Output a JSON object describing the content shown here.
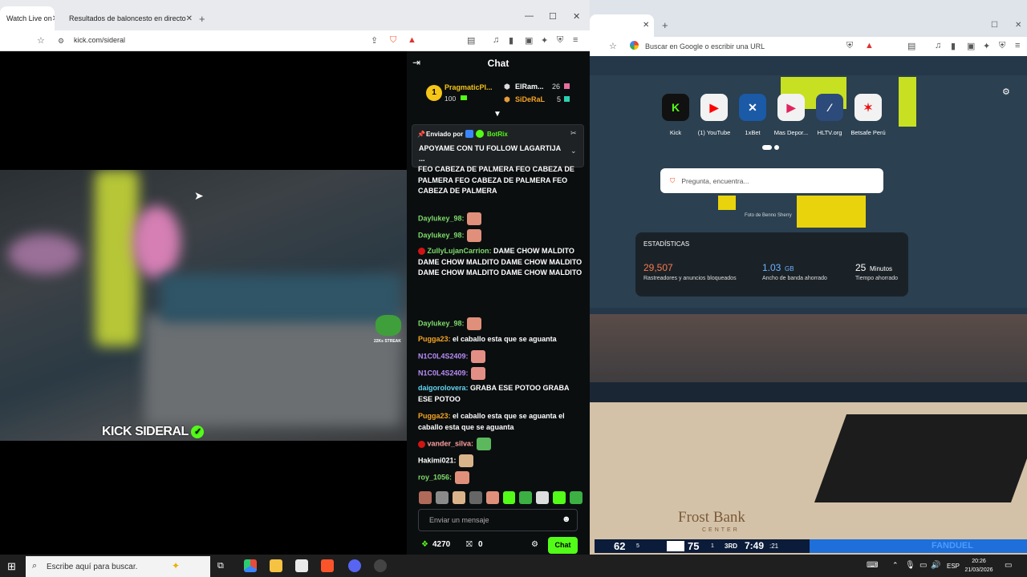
{
  "left_browser": {
    "tabs": [
      {
        "title": "Watch Live on",
        "active": true
      },
      {
        "title": "Resultados de baloncesto en directo",
        "active": false
      }
    ],
    "new_tab": "+",
    "url": "kick.com/sideral"
  },
  "stream": {
    "overlay_logo": "KICK SIDERAL",
    "kick_word": "KICK",
    "channel_word": "SIDERAL",
    "sticker_caption": "22Ks STREAK"
  },
  "chat": {
    "title": "Chat",
    "leaderboard": [
      {
        "rank": "1",
        "name": "PragmaticPl...",
        "amount": "100"
      },
      {
        "name": "ElRam...",
        "amount": "26"
      },
      {
        "name": "SiDeRaL",
        "amount": "5"
      }
    ],
    "pinned": {
      "sent_by_label": "Enviado por",
      "sender": "BotRix",
      "text": "APOYAME CON TU FOLLOW LAGARTIJA",
      "ellipsis": "..."
    },
    "messages": [
      {
        "user": "",
        "text": "FEO CABEZA DE PALMERA  FEO CABEZA DE PALMERA  FEO CABEZA DE PALMERA  FEO CABEZA DE PALMERA"
      },
      {
        "user": "Daylukey_98:",
        "text": ""
      },
      {
        "user": "Daylukey_98:",
        "text": ""
      },
      {
        "user": "ZullyLujanCarrion:",
        "text": "DAME CHOW MALDITO  DAME CHOW MALDITO  DAME CHOW MALDITO  DAME CHOW MALDITO  DAME CHOW MALDITO"
      },
      {
        "user": "Daylukey_98:",
        "text": ""
      },
      {
        "user": "Pugga23:",
        "text": "el caballo esta que se aguanta"
      },
      {
        "user": "N1C0L4S2409:",
        "text": ""
      },
      {
        "user": "N1C0L4S2409:",
        "text": ""
      },
      {
        "user": "daigorolovera:",
        "text": "GRABA ESE POTOO  GRABA ESE POTOO"
      },
      {
        "user": "Pugga23:",
        "text": "el caballo esta que se aguanta el caballo esta que se aguanta"
      },
      {
        "user": "vander_silva:",
        "text": ""
      },
      {
        "user": "Hakimi021:",
        "text": ""
      },
      {
        "user": "roy_1056:",
        "text": ""
      }
    ],
    "input_placeholder": "Enviar un mensaje",
    "points": "4270",
    "second_count": "0",
    "send_label": "Chat"
  },
  "right_browser": {
    "omnibox_placeholder": "Buscar en Google o escribir una URL",
    "shortcuts": [
      "Kick",
      "(1) YouTube",
      "1xBet",
      "Mas Depor...",
      "HLTV.org",
      "Betsafe Perú"
    ],
    "search_placeholder": "Pregunta, encuentra...",
    "photo_credit": "Foto de Benno Sherry",
    "stats": {
      "title": "ESTADÍSTICAS",
      "trackers_value": "29,507",
      "trackers_label": "Rastreadores y anuncios bloqueados",
      "bandwidth_value": "1.03",
      "bandwidth_unit": "GB",
      "bandwidth_label": "Ancho de banda ahorrado",
      "time_value": "25",
      "time_unit": "Minutos",
      "time_label": "Tiempo ahorrado"
    }
  },
  "game": {
    "arena_text": "Frost Bank",
    "arena_sub": "CENTER",
    "home_score": "62",
    "home_fouls": "5",
    "away_score": "75",
    "away_fouls": "1",
    "quarter": "3RD",
    "clock": "7:49",
    "shot_clock": ":21",
    "ad_text": "FANDUEL"
  },
  "taskbar": {
    "search_placeholder": "Escribe aquí para buscar.",
    "language": "ESP",
    "time": "20:26",
    "date": "21/03/2026"
  }
}
